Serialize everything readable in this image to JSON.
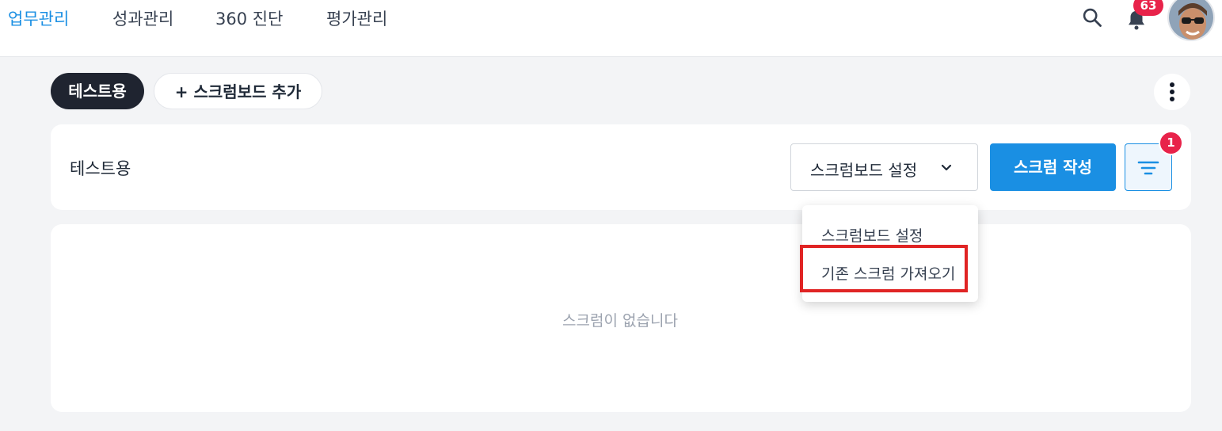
{
  "topnav": {
    "items": [
      {
        "label": "업무관리",
        "active": true
      },
      {
        "label": "성과관리",
        "active": false
      },
      {
        "label": "360 진단",
        "active": false
      },
      {
        "label": "평가관리",
        "active": false
      }
    ],
    "search_icon": "search-icon",
    "bell_icon": "bell-icon",
    "notification_count": "63",
    "avatar": "user-avatar"
  },
  "boards": {
    "tabs": [
      {
        "label": "테스트용",
        "active": true
      }
    ],
    "add_label": "+ 스크럼보드 추가",
    "more_icon": "more-vertical-icon"
  },
  "header": {
    "board_name": "테스트용",
    "settings_dropdown_label": "스크럼보드 설정",
    "write_button_label": "스크럼 작성",
    "filter_badge": "1",
    "filter_icon": "filter-icon"
  },
  "dropdown_menu": {
    "items": [
      {
        "label": "스크럼보드 설정"
      },
      {
        "label": "기존 스크럼 가져오기",
        "highlighted": true
      }
    ]
  },
  "content": {
    "empty_message": "스크럼이 없습니다"
  },
  "colors": {
    "accent": "#1a8fe3",
    "badge": "#e8234a",
    "highlight": "#e02424",
    "dark_tab": "#1f2430",
    "background": "#f3f4f6"
  }
}
